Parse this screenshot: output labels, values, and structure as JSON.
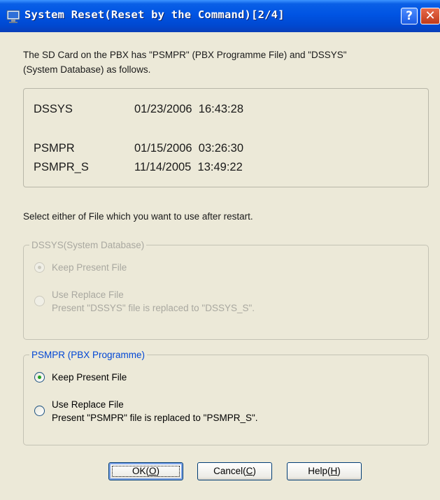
{
  "window": {
    "title": "System Reset(Reset by the Command)[2/4]",
    "help_glyph": "?",
    "close_glyph": "✕",
    "icons": {
      "app": "computer-icon",
      "help": "help-icon",
      "close": "close-icon"
    }
  },
  "intro": {
    "line1": "The SD Card on the PBX has \"PSMPR\" (PBX Programme File) and  \"DSSYS\"",
    "line2": "(System Database) as follows."
  },
  "files": [
    {
      "name": "DSSYS",
      "date": "01/23/2006",
      "time": "16:43:28"
    },
    {
      "name": "PSMPR",
      "date": "01/15/2006",
      "time": "03:26:30"
    },
    {
      "name": "PSMPR_S",
      "date": "11/14/2005",
      "time": "13:49:22"
    }
  ],
  "select_prompt": "Select either of File which you want to use after restart.",
  "dssys_group": {
    "title": "DSSYS(System Database)",
    "enabled": false,
    "keep_label": "Keep Present File",
    "keep_selected": true,
    "replace_label": "Use Replace File",
    "replace_desc": "Present \"DSSYS\" file is replaced to \"DSSYS_S\".",
    "replace_selected": false
  },
  "psmpr_group": {
    "title": "PSMPR (PBX Programme)",
    "enabled": true,
    "keep_label": "Keep Present File",
    "keep_selected": true,
    "replace_label": "Use Replace File",
    "replace_desc": "Present \"PSMPR\" file is replaced to \"PSMPR_S\".",
    "replace_selected": false
  },
  "buttons": {
    "ok": {
      "label": "OK(",
      "key": "O",
      "suffix": ")"
    },
    "cancel": {
      "label": "Cancel(",
      "key": "C",
      "suffix": ")"
    },
    "help": {
      "label": "Help(",
      "key": "H",
      "suffix": ")"
    }
  },
  "colors": {
    "titlebar": "#0054e3",
    "dialog_bg": "#ece9d8",
    "group_title_active": "#0046d5",
    "disabled_text": "#a9a8a0",
    "radio_dot": "#21a121"
  }
}
